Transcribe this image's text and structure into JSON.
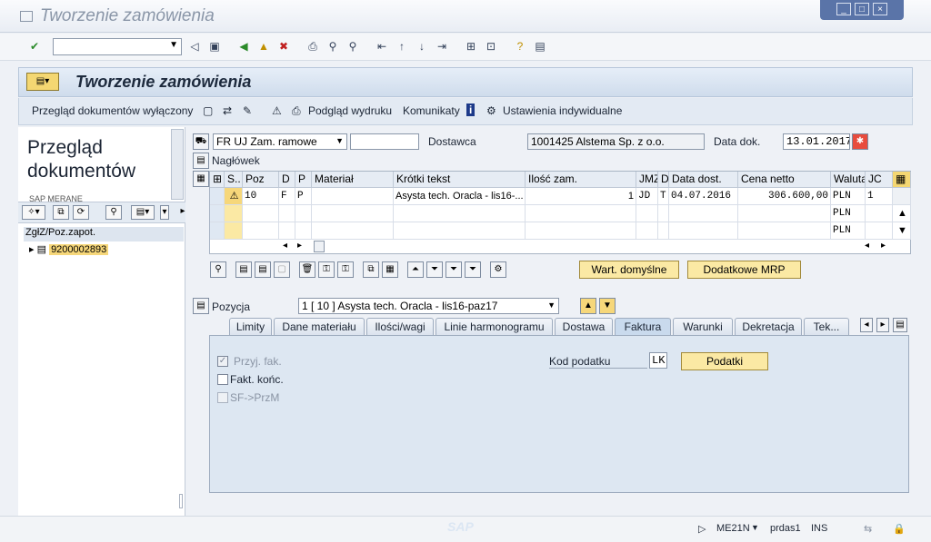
{
  "window": {
    "title": "Tworzenie zamówienia",
    "controls": [
      "_",
      "□",
      "×"
    ]
  },
  "system_toolbar": {
    "command_field_value": "",
    "icons": [
      "enter-icon",
      "back-icon",
      "save-icon",
      "exit-icon",
      "cancel-icon",
      "print-icon",
      "find-icon",
      "find-next-icon",
      "first-page-icon",
      "prev-page-icon",
      "next-page-icon",
      "last-page-icon",
      "new-session-icon",
      "shortcut-icon",
      "help-icon",
      "customize-icon"
    ]
  },
  "app": {
    "title": "Tworzenie zamówienia",
    "toolbar": {
      "doc_overview": "Przegląd dokumentów wyłączony",
      "print_preview": "Podgląd wydruku",
      "messages": "Komunikaty",
      "personal_settings": "Ustawienia indywidualne"
    }
  },
  "left_pane": {
    "title_line1": "Przegląd",
    "title_line2": "dokumentów",
    "subtitle": "SAP MERANE",
    "column_header": "ZgłZ/Poz.zapot.",
    "items": [
      "9200002893"
    ]
  },
  "header": {
    "order_type": "FR UJ Zam. ramowe",
    "order_number": "",
    "vendor_label": "Dostawca",
    "vendor_value": "1001425 Alstema Sp. z o.o.",
    "date_label": "Data dok.",
    "date_value": "13.01.2017",
    "header_toggle": "Nagłówek"
  },
  "items_table": {
    "columns": [
      "S..",
      "Poz",
      "D",
      "P",
      "Materiał",
      "Krótki tekst",
      "Ilość zam.",
      "JMZ",
      "D",
      "Data dost.",
      "Cena netto",
      "Waluta",
      "JC"
    ],
    "rows": [
      {
        "status": "⚠",
        "poz": "10",
        "d": "F",
        "p": "P",
        "material": "",
        "text": "Asysta tech. Oracla - lis16-...",
        "qty": "1",
        "jmz": "JD",
        "d2": "T",
        "date": "04.07.2016",
        "price": "306.600,00",
        "currency": "PLN",
        "jc": "1"
      },
      {
        "status": "",
        "poz": "",
        "d": "",
        "p": "",
        "material": "",
        "text": "",
        "qty": "",
        "jmz": "",
        "d2": "",
        "date": "",
        "price": "",
        "currency": "PLN",
        "jc": ""
      },
      {
        "status": "",
        "poz": "",
        "d": "",
        "p": "",
        "material": "",
        "text": "",
        "qty": "",
        "jmz": "",
        "d2": "",
        "date": "",
        "price": "",
        "currency": "PLN",
        "jc": ""
      }
    ],
    "buttons": {
      "default_values": "Wart. domyślne",
      "additional_mrp": "Dodatkowe MRP"
    }
  },
  "item_detail": {
    "label": "Pozycja",
    "selected": "1 [ 10 ] Asysta tech. Oracla - lis16-paz17",
    "tabs": [
      "Limity",
      "Dane materiału",
      "Ilości/wagi",
      "Linie harmonogramu",
      "Dostawa",
      "Faktura",
      "Warunki",
      "Dekretacja",
      "Tek..."
    ],
    "active_tab": "Faktura",
    "invoice": {
      "gr_invoice_label": "Przyj. fak.",
      "final_invoice_label": "Fakt. końc.",
      "sf_prz_label": "SF->PrzM",
      "gr_invoice_checked": true,
      "tax_code_label": "Kod podatku",
      "tax_code_value": "LK",
      "taxes_button": "Podatki"
    }
  },
  "status_bar": {
    "logo": "SAP",
    "transaction": "ME21N",
    "server": "prdas1",
    "mode": "INS"
  }
}
